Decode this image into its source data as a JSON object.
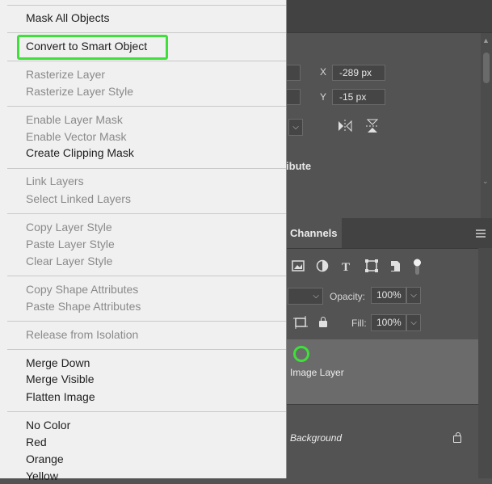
{
  "menu": {
    "items": [
      {
        "label": "Mask All Objects",
        "enabled": true
      },
      {
        "label": "Convert to Smart Object",
        "enabled": true
      },
      {
        "label": "Rasterize Layer",
        "enabled": false
      },
      {
        "label": "Rasterize Layer Style",
        "enabled": false
      },
      {
        "label": "Enable Layer Mask",
        "enabled": false
      },
      {
        "label": "Enable Vector Mask",
        "enabled": false
      },
      {
        "label": "Create Clipping Mask",
        "enabled": true
      },
      {
        "label": "Link Layers",
        "enabled": false
      },
      {
        "label": "Select Linked Layers",
        "enabled": false
      },
      {
        "label": "Copy Layer Style",
        "enabled": false
      },
      {
        "label": "Paste Layer Style",
        "enabled": false
      },
      {
        "label": "Clear Layer Style",
        "enabled": false
      },
      {
        "label": "Copy Shape Attributes",
        "enabled": false
      },
      {
        "label": "Paste Shape Attributes",
        "enabled": false
      },
      {
        "label": "Release from Isolation",
        "enabled": false
      },
      {
        "label": "Merge Down",
        "enabled": true
      },
      {
        "label": "Merge Visible",
        "enabled": true
      },
      {
        "label": "Flatten Image",
        "enabled": true
      },
      {
        "label": "No Color",
        "enabled": true
      },
      {
        "label": "Red",
        "enabled": true
      },
      {
        "label": "Orange",
        "enabled": true
      },
      {
        "label": "Yellow",
        "enabled": true
      }
    ]
  },
  "properties": {
    "x_label": "X",
    "x_value": "-289 px",
    "y_label": "Y",
    "y_value": "-15 px",
    "partial_heading": "ribute"
  },
  "layers_panel": {
    "tab_channels": "Channels",
    "opacity_label": "Opacity:",
    "opacity_value": "100%",
    "fill_label": "Fill:",
    "fill_value": "100%",
    "layers": [
      {
        "name": "Image Layer",
        "selected": true
      },
      {
        "name": "Background",
        "locked": true
      }
    ]
  },
  "colors": {
    "highlight": "#3fe03a",
    "menu_bg": "#f0f0f0",
    "panel_bg": "#535353"
  }
}
